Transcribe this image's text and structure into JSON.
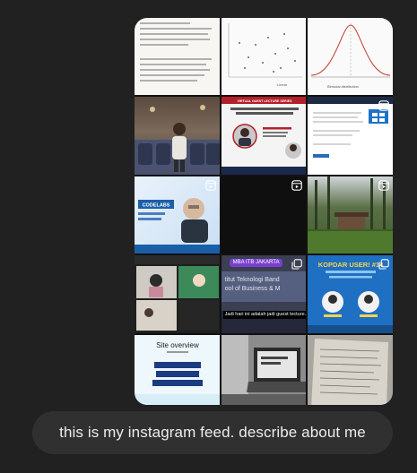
{
  "colors": {
    "background": "#212121",
    "bubble": "#303030",
    "bubble_text": "#ececec"
  },
  "feed": {
    "tiles": [
      {
        "kind": "document",
        "badge": "none"
      },
      {
        "kind": "scatter-plot",
        "badge": "none",
        "text": "Linear"
      },
      {
        "kind": "bell-curve",
        "badge": "none",
        "text": "Bimodal distribution"
      },
      {
        "kind": "event-photo",
        "badge": "none"
      },
      {
        "kind": "webinar-poster",
        "badge": "none",
        "title": "VIRTUAL GUEST LECTURE SERIES"
      },
      {
        "kind": "screenshot",
        "badge": "reel-icon"
      },
      {
        "kind": "speaker-poster",
        "badge": "reel-icon",
        "text": "CODELABS"
      },
      {
        "kind": "dark-video",
        "badge": "reel-icon"
      },
      {
        "kind": "outdoor-photo",
        "badge": "reel-icon"
      },
      {
        "kind": "video-call",
        "badge": "none"
      },
      {
        "kind": "sign-photo",
        "badge": "carousel-icon",
        "tag": "MBA ITB JAKARTA",
        "sign_lines": [
          "titut Teknologi Band",
          "ool of Business & M"
        ],
        "caption": "Jadi hari ini adalah jadi guest lecture..."
      },
      {
        "kind": "event-poster",
        "badge": "carousel-icon",
        "title": "KOPDAR USER! #14"
      },
      {
        "kind": "slides",
        "badge": "none",
        "title": "Site overview"
      },
      {
        "kind": "laptop-photo",
        "badge": "none"
      },
      {
        "kind": "paper-photo",
        "badge": "none"
      }
    ]
  },
  "message": {
    "text": "this is my instagram feed. describe about me"
  }
}
